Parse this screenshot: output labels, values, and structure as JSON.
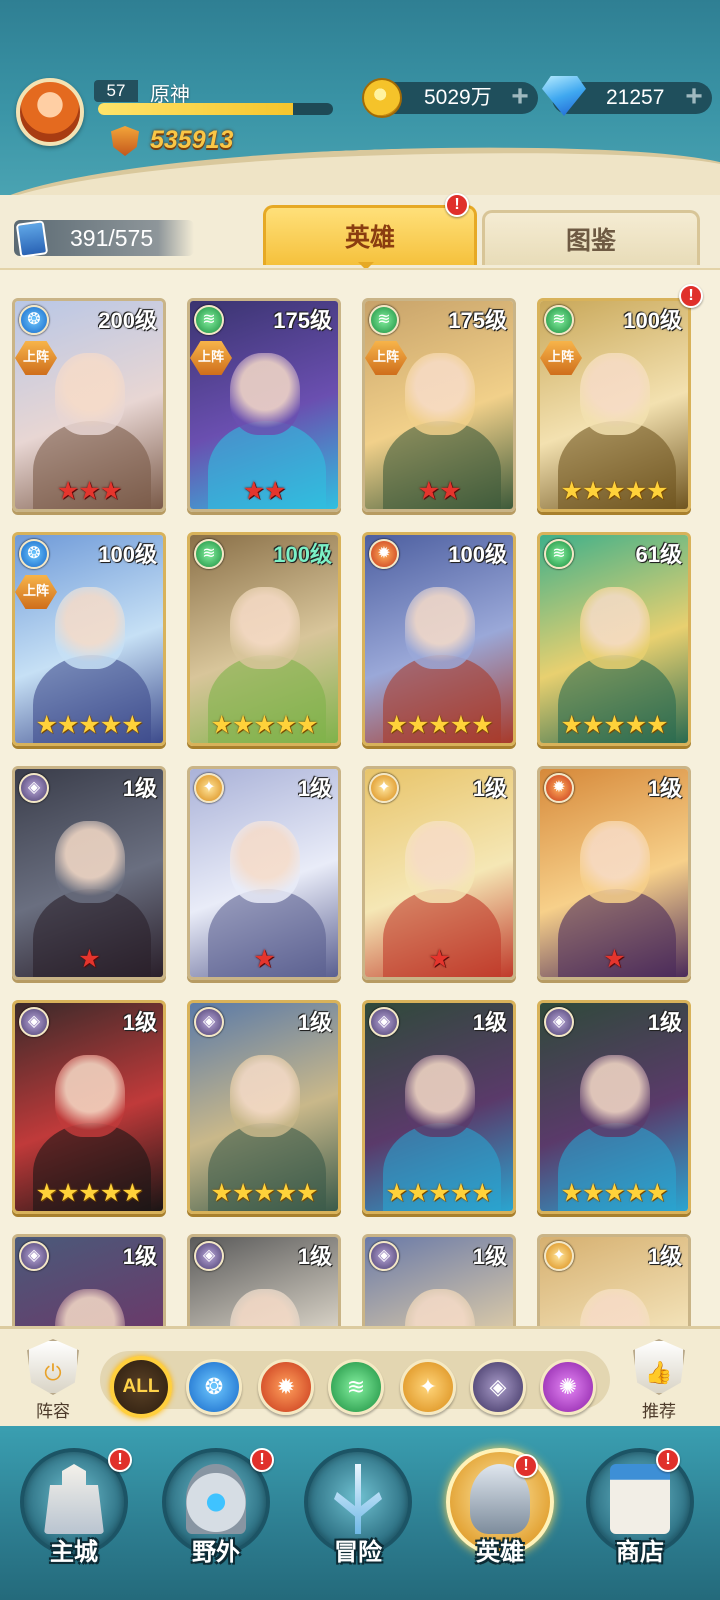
{
  "player": {
    "level": "57",
    "name": "原神",
    "xp_progress": 0.83,
    "power": "535913"
  },
  "currency": {
    "gold": "5029万",
    "gems": "21257",
    "plus": "+"
  },
  "collection": {
    "count": "391/575"
  },
  "tabs": [
    {
      "label": "英雄",
      "active": true,
      "alert": "!"
    },
    {
      "label": "图鉴",
      "active": false
    }
  ],
  "deploy_label": "上阵",
  "heroes": [
    {
      "level": "200级",
      "element": "water",
      "deployed": true,
      "stars": 3,
      "star_color": "red",
      "palette": [
        "#b9c7e6",
        "#e8d6d3",
        "#7a5a48"
      ]
    },
    {
      "level": "175级",
      "element": "wind",
      "deployed": true,
      "stars": 2,
      "star_color": "red",
      "palette": [
        "#3a3470",
        "#6a4fb0",
        "#30c0e0"
      ]
    },
    {
      "level": "175级",
      "element": "wind",
      "deployed": true,
      "stars": 2,
      "star_color": "red",
      "palette": [
        "#c8a36a",
        "#f1d08a",
        "#3d5a3a"
      ]
    },
    {
      "level": "100级",
      "element": "wind",
      "deployed": true,
      "stars": 5,
      "star_color": "gold",
      "palette": [
        "#c9a85a",
        "#f3e1b0",
        "#6f5520"
      ],
      "alert": "!"
    },
    {
      "level": "100级",
      "element": "water",
      "deployed": true,
      "stars": 5,
      "star_color": "gold",
      "palette": [
        "#6f9ad8",
        "#c6e0f5",
        "#3d4b8c"
      ]
    },
    {
      "level": "100级",
      "element": "wind",
      "deployed": false,
      "stars": 5,
      "star_color": "gold",
      "palette": [
        "#8a7048",
        "#d8c59a",
        "#7fb24a"
      ],
      "level_color": "green"
    },
    {
      "level": "100级",
      "element": "fire",
      "deployed": false,
      "stars": 5,
      "star_color": "gold",
      "palette": [
        "#4d5fa0",
        "#9aa8d8",
        "#a83a2a"
      ]
    },
    {
      "level": "61级",
      "element": "wind",
      "deployed": false,
      "stars": 5,
      "star_color": "gold",
      "palette": [
        "#3fb08a",
        "#e8d070",
        "#2a6a50"
      ]
    },
    {
      "level": "1级",
      "element": "dark",
      "deployed": false,
      "stars": 1,
      "star_color": "red",
      "palette": [
        "#3a3d4a",
        "#6a6f80",
        "#2a1f2a"
      ]
    },
    {
      "level": "1级",
      "element": "light",
      "deployed": false,
      "stars": 1,
      "star_color": "red",
      "palette": [
        "#aab2d8",
        "#e9ecf8",
        "#5a5f90"
      ]
    },
    {
      "level": "1级",
      "element": "light",
      "deployed": false,
      "stars": 1,
      "star_color": "red",
      "palette": [
        "#e8c46a",
        "#f5e7b5",
        "#c03a2a"
      ]
    },
    {
      "level": "1级",
      "element": "fire",
      "deployed": false,
      "stars": 1,
      "star_color": "red",
      "palette": [
        "#d6893a",
        "#f7d08a",
        "#4a2a5a"
      ]
    },
    {
      "level": "1级",
      "element": "dark",
      "deployed": false,
      "stars": 5,
      "star_color": "gold",
      "palette": [
        "#3a2a2a",
        "#c03a3a",
        "#1a1515"
      ]
    },
    {
      "level": "1级",
      "element": "dark",
      "deployed": false,
      "stars": 5,
      "star_color": "gold",
      "palette": [
        "#5a7aa8",
        "#c9b88a",
        "#3a5a4a"
      ]
    },
    {
      "level": "1级",
      "element": "dark",
      "deployed": false,
      "stars": 5,
      "star_color": "gold",
      "palette": [
        "#2f4a3a",
        "#5a3a6a",
        "#2aa5d0"
      ]
    },
    {
      "level": "1级",
      "element": "dark",
      "deployed": false,
      "stars": 5,
      "star_color": "gold",
      "palette": [
        "#2f4a3a",
        "#5a3a6a",
        "#2aa5d0"
      ]
    },
    {
      "level": "1级",
      "element": "dark",
      "deployed": false,
      "stars": 0,
      "star_color": "gold",
      "palette": [
        "#4a5a7a",
        "#6a3a6a",
        "#2aa5d0"
      ]
    },
    {
      "level": "1级",
      "element": "dark",
      "deployed": false,
      "stars": 0,
      "star_color": "gold",
      "palette": [
        "#5a5a5a",
        "#d6d0c4",
        "#4a8a3a"
      ]
    },
    {
      "level": "1级",
      "element": "dark",
      "deployed": false,
      "stars": 0,
      "star_color": "gold",
      "palette": [
        "#6a7aa8",
        "#d8c8a8",
        "#4a4a6a"
      ]
    },
    {
      "level": "1级",
      "element": "light",
      "deployed": false,
      "stars": 0,
      "star_color": "gold",
      "palette": [
        "#d6b070",
        "#f3e2b8",
        "#7a5a3a"
      ]
    }
  ],
  "filter": {
    "lineup_label": "阵容",
    "recommend_label": "推荐",
    "all_label": "ALL",
    "elements": [
      "water",
      "fire",
      "wind",
      "light",
      "dark",
      "arcane"
    ]
  },
  "nav": [
    {
      "label": "主城",
      "alert": "!",
      "active": false
    },
    {
      "label": "野外",
      "alert": "!",
      "active": false
    },
    {
      "label": "冒险",
      "active": false
    },
    {
      "label": "英雄",
      "alert": "!",
      "active": true
    },
    {
      "label": "商店",
      "alert": "!",
      "active": false
    }
  ],
  "colors": {
    "header_teal": "#3a94a6",
    "tab_active": "#f5c13c",
    "power_gold": "#f9c646",
    "alert_red": "#e0302b"
  }
}
